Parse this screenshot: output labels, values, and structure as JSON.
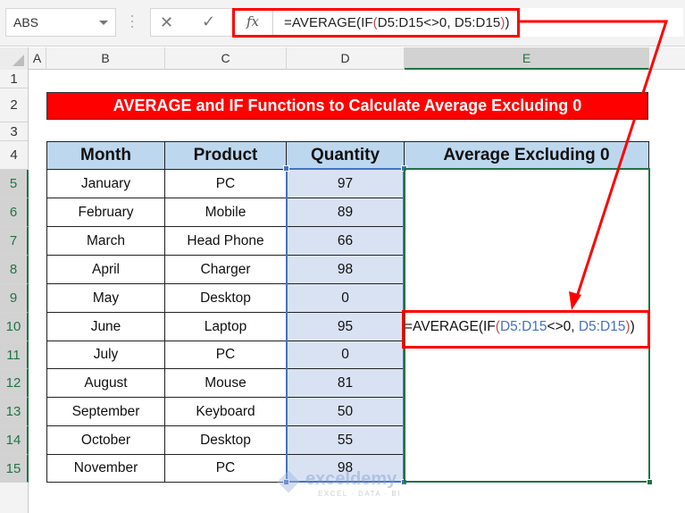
{
  "formula_bar": {
    "name_box": "ABS",
    "cancel_icon": "✕",
    "enter_icon": "✓",
    "fx_label": "fx",
    "formula_parts": [
      "=AVERAGE(IF",
      "(",
      "D5:D15",
      "<>0, ",
      "D5:D15",
      ")",
      ")"
    ]
  },
  "columns": [
    "A",
    "B",
    "C",
    "D",
    "E"
  ],
  "rows": [
    "1",
    "2",
    "3",
    "4",
    "5",
    "6",
    "7",
    "8",
    "9",
    "10",
    "11",
    "12",
    "13",
    "14",
    "15"
  ],
  "title": "AVERAGE and IF Functions to Calculate Average Excluding 0",
  "table": {
    "headers": [
      "Month",
      "Product",
      "Quantity",
      "Average Excluding 0"
    ],
    "rows": [
      {
        "month": "January",
        "product": "PC",
        "quantity": "97"
      },
      {
        "month": "February",
        "product": "Mobile",
        "quantity": "89"
      },
      {
        "month": "March",
        "product": "Head Phone",
        "quantity": "66"
      },
      {
        "month": "April",
        "product": "Charger",
        "quantity": "98"
      },
      {
        "month": "May",
        "product": "Desktop",
        "quantity": "0"
      },
      {
        "month": "June",
        "product": "Laptop",
        "quantity": "95"
      },
      {
        "month": "July",
        "product": "PC",
        "quantity": "0"
      },
      {
        "month": "August",
        "product": "Mouse",
        "quantity": "81"
      },
      {
        "month": "September",
        "product": "Keyboard",
        "quantity": "50"
      },
      {
        "month": "October",
        "product": "Desktop",
        "quantity": "55"
      },
      {
        "month": "November",
        "product": "PC",
        "quantity": "98"
      }
    ]
  },
  "cell_formula_parts": [
    "=AVERAGE(IF",
    "(",
    "D5:D15",
    "<>0, ",
    "D5:D15",
    ")",
    ")"
  ],
  "watermark": {
    "brand": "exceldemy",
    "tagline": "EXCEL · DATA · BI"
  },
  "colors": {
    "highlight": "#ff0000",
    "header_fill": "#bdd7ee",
    "quantity_fill": "#d9e2f3",
    "selection_green": "#217346",
    "range_blue": "#4472c4"
  }
}
